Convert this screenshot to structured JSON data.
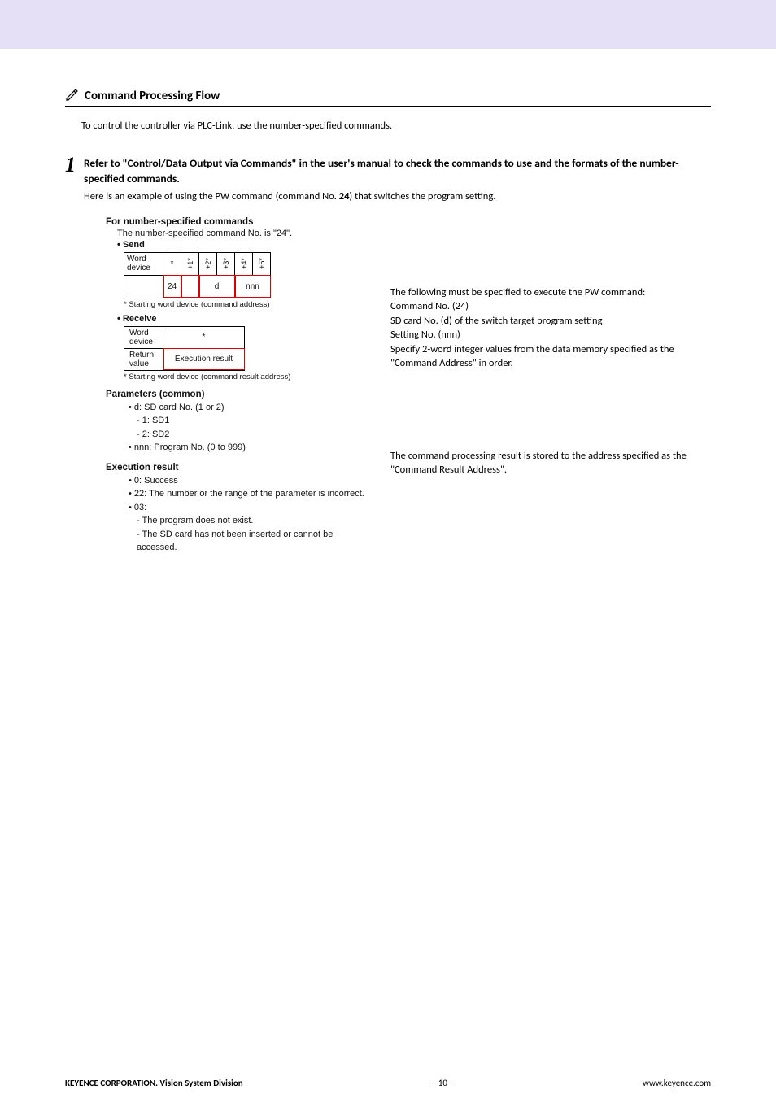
{
  "section": {
    "title": "Command Processing Flow"
  },
  "intro": "To control the controller via PLC-Link, use the number-specified commands.",
  "step1": {
    "num": "1",
    "title_a": "Refer to \"Control/Data Output via Commands\" in the user's manual to check the commands to use and the formats of the number-specified commands.",
    "desc_a": "Here is an example of using the PW command (command No. ",
    "desc_cmd": "24",
    "desc_b": ") that switches the program setting."
  },
  "left": {
    "sub": "For number-specified commands",
    "note": "The number-specified command No. is \"24\".",
    "send": "• Send",
    "send_label": "Word device",
    "send_cols": {
      "c0": "*",
      "c1": "+1*",
      "c2": "+2*",
      "c3": "+3*",
      "c4": "+4*",
      "c5": "+5*"
    },
    "send_vals": {
      "v0": "24",
      "v1": "",
      "v2": "d",
      "v3": "nnn"
    },
    "send_foot": "* Starting word device (command address)",
    "recv": "• Receive",
    "recv_label": "Word device",
    "recv_star": "*",
    "recv_ret": "Return value",
    "recv_val": "Execution result",
    "recv_foot": "* Starting word device (command result address)",
    "para_h": "Parameters (common)",
    "para": {
      "d": "d: SD card No. (1 or 2)",
      "d1": "1: SD1",
      "d2": "2: SD2",
      "nnn": "nnn: Program No. (0 to 999)"
    },
    "exec_h": "Execution result",
    "exec": {
      "r0": "0: Success",
      "r22": "22: The number or the range of the parameter is incorrect.",
      "r03": "03:",
      "r03a": "The program does not exist.",
      "r03b": "The SD card has not been inserted or cannot be accessed."
    }
  },
  "right": {
    "p1a": "The following must be specified to execute the PW command:",
    "p1b": "Command No. (24)",
    "p1c": "SD card No. (d) of the switch target program setting",
    "p1d": "Setting No. (nnn)",
    "p1e": "Specify 2-word integer values from the data memory specified as the \"Command Address\" in order.",
    "p2": "The command processing result is stored to the address specified as the \"Command Result Address\"."
  },
  "footer": {
    "left": "KEYENCE CORPORATION. Vision System Division",
    "center": "- 10 -",
    "right": "www.keyence.com"
  }
}
